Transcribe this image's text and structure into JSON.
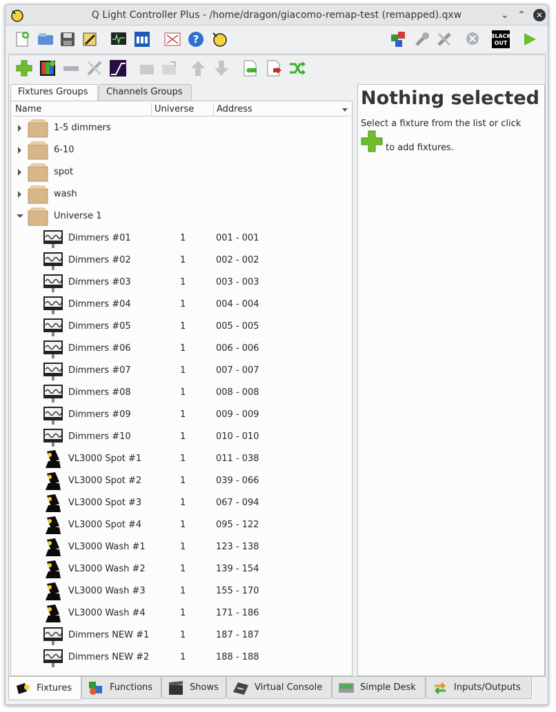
{
  "window": {
    "title": "Q Light Controller Plus - /home/dragon/giacomo-remap-test (remapped).qxw",
    "minimize_glyph": "⌄",
    "maximize_glyph": "⌃",
    "close_glyph": "✕"
  },
  "main_toolbar": {
    "blackout_label_top": "BLACK",
    "blackout_label_bottom": "OUT"
  },
  "tree_tabs": [
    {
      "label": "Fixtures Groups",
      "active": true
    },
    {
      "label": "Channels Groups",
      "active": false
    }
  ],
  "tree_columns": {
    "name": "Name",
    "universe": "Universe",
    "address": "Address"
  },
  "groups": [
    {
      "name": "1-5 dimmers"
    },
    {
      "name": "6-10"
    },
    {
      "name": "spot"
    },
    {
      "name": "wash"
    },
    {
      "name": "Universe 1"
    }
  ],
  "fixtures": [
    {
      "name": "Dimmers #01",
      "universe": "1",
      "address": "001 - 001",
      "type": "dimmer"
    },
    {
      "name": "Dimmers #02",
      "universe": "1",
      "address": "002 - 002",
      "type": "dimmer"
    },
    {
      "name": "Dimmers #03",
      "universe": "1",
      "address": "003 - 003",
      "type": "dimmer"
    },
    {
      "name": "Dimmers #04",
      "universe": "1",
      "address": "004 - 004",
      "type": "dimmer"
    },
    {
      "name": "Dimmers #05",
      "universe": "1",
      "address": "005 - 005",
      "type": "dimmer"
    },
    {
      "name": "Dimmers #06",
      "universe": "1",
      "address": "006 - 006",
      "type": "dimmer"
    },
    {
      "name": "Dimmers #07",
      "universe": "1",
      "address": "007 - 007",
      "type": "dimmer"
    },
    {
      "name": "Dimmers #08",
      "universe": "1",
      "address": "008 - 008",
      "type": "dimmer"
    },
    {
      "name": "Dimmers #09",
      "universe": "1",
      "address": "009 - 009",
      "type": "dimmer"
    },
    {
      "name": "Dimmers #10",
      "universe": "1",
      "address": "010 - 010",
      "type": "dimmer"
    },
    {
      "name": "VL3000 Spot #1",
      "universe": "1",
      "address": "011 - 038",
      "type": "moving-head"
    },
    {
      "name": "VL3000 Spot #2",
      "universe": "1",
      "address": "039 - 066",
      "type": "moving-head"
    },
    {
      "name": "VL3000 Spot #3",
      "universe": "1",
      "address": "067 - 094",
      "type": "moving-head"
    },
    {
      "name": "VL3000 Spot #4",
      "universe": "1",
      "address": "095 - 122",
      "type": "moving-head"
    },
    {
      "name": "VL3000 Wash #1",
      "universe": "1",
      "address": "123 - 138",
      "type": "moving-head"
    },
    {
      "name": "VL3000 Wash #2",
      "universe": "1",
      "address": "139 - 154",
      "type": "moving-head"
    },
    {
      "name": "VL3000 Wash #3",
      "universe": "1",
      "address": "155 - 170",
      "type": "moving-head"
    },
    {
      "name": "VL3000 Wash #4",
      "universe": "1",
      "address": "171 - 186",
      "type": "moving-head"
    },
    {
      "name": "Dimmers NEW #1",
      "universe": "1",
      "address": "187 - 187",
      "type": "dimmer"
    },
    {
      "name": "Dimmers NEW #2",
      "universe": "1",
      "address": "188 - 188",
      "type": "dimmer"
    }
  ],
  "info_panel": {
    "title": "Nothing selected",
    "line1": "Select a fixture from the list or click",
    "line2": "to add fixtures."
  },
  "bottom_tabs": [
    {
      "label": "Fixtures",
      "icon": "fixture-icon",
      "active": true
    },
    {
      "label": "Functions",
      "icon": "functions-icon",
      "active": false
    },
    {
      "label": "Shows",
      "icon": "clapperboard-icon",
      "active": false
    },
    {
      "label": "Virtual Console",
      "icon": "console-icon",
      "active": false
    },
    {
      "label": "Simple Desk",
      "icon": "desk-icon",
      "active": false
    },
    {
      "label": "Inputs/Outputs",
      "icon": "io-arrows-icon",
      "active": false
    }
  ],
  "colors": {
    "accent_green": "#5fb322",
    "folder": "#d7b68a",
    "titlebar": "#e3e5e7"
  }
}
